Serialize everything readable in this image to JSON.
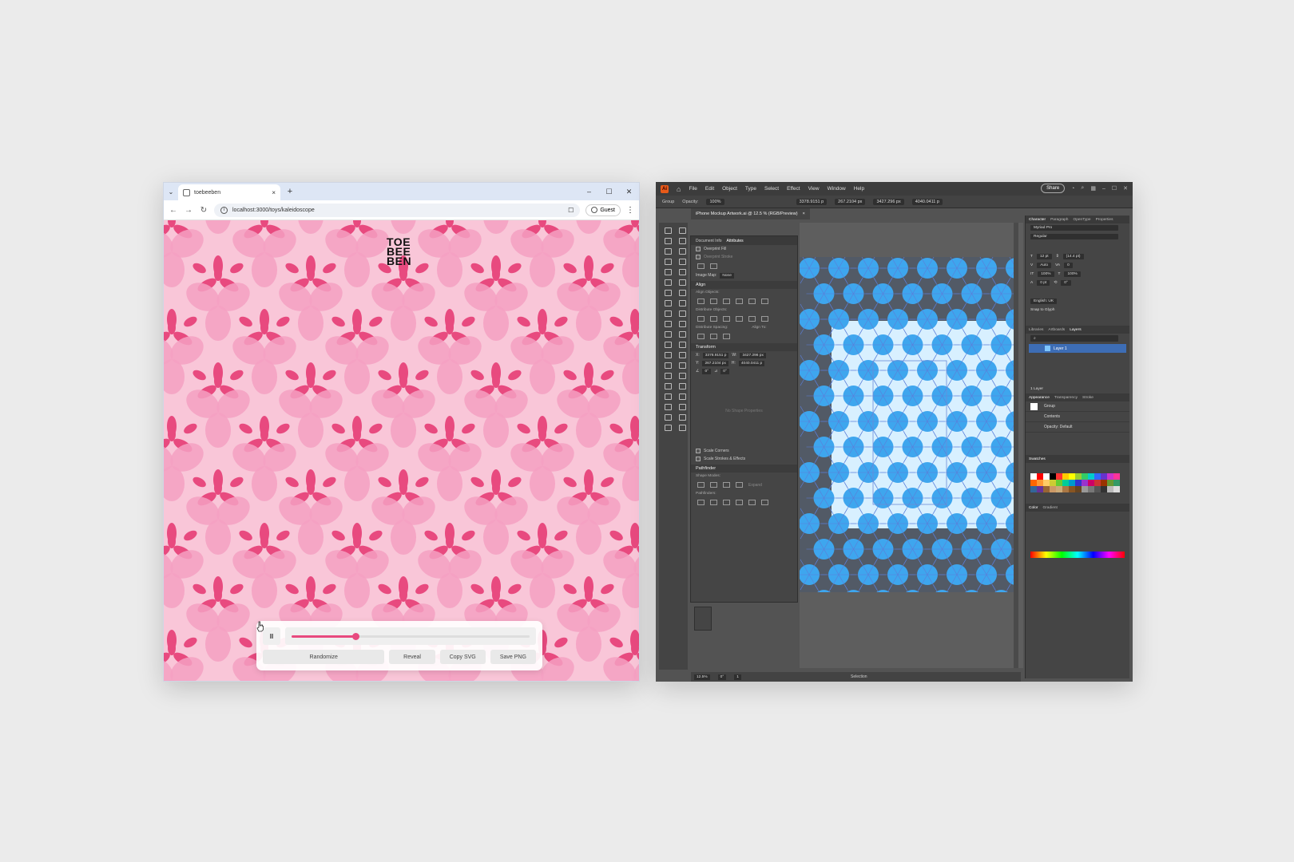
{
  "browser": {
    "tab_title": "toebeeben",
    "tab_close": "×",
    "new_tab": "+",
    "tab_menu": "⌄",
    "win_min": "–",
    "win_max": "☐",
    "win_close": "✕",
    "back": "←",
    "forward": "→",
    "reload": "↻",
    "url": "localhost:3000/toys/kaleidoscope",
    "bookmark": "☐",
    "profile_label": "Guest",
    "menu": "⋮"
  },
  "app": {
    "logo_lines": [
      "TOE",
      "BEE",
      "BEN"
    ],
    "background_color": "#f9c6d8",
    "petal_dark": "#e84a7f",
    "petal_light": "#f4a0c2",
    "pause_label": "II",
    "slider_progress": 0.27,
    "buttons": {
      "randomize": "Randomize",
      "reveal": "Reveal",
      "copy_svg": "Copy SVG",
      "save_png": "Save PNG"
    }
  },
  "illustrator": {
    "logo_text": "Ai",
    "home": "⌂",
    "menus": [
      "File",
      "Edit",
      "Object",
      "Type",
      "Select",
      "Effect",
      "View",
      "Window",
      "Help"
    ],
    "share": "Share",
    "control_bar": {
      "group_label": "Group",
      "opacity_label": "Opacity:",
      "opacity_value": "100%",
      "x_value": "3378.9151 p",
      "y_value": "267.2104 px",
      "w_value": "3427.296 px",
      "h_value": "4040.0411 p"
    },
    "doc_tab": "iPhone Mockup Artwork.ai @ 12.5 % (RGB/Preview)",
    "doc_tab_close": "×",
    "left_panel": {
      "tabs": [
        "Document Info",
        "Attributes"
      ],
      "overprint_fill": "Overprint Fill",
      "overprint_stroke": "Overprint Stroke",
      "image_map_label": "Image Map:",
      "image_map_value": "None",
      "align_head": "Align",
      "align_objects": "Align Objects:",
      "distribute_objects": "Distribute Objects:",
      "distribute_spacing": "Distribute Spacing:",
      "align_to": "Align To:",
      "transform_head": "Transform",
      "x_field": "3378.9151 p",
      "y_field": "267.2104 px",
      "w_field": "3427.296 px",
      "h_field": "4040.0411 p",
      "angle_field": "0°",
      "shear_field": "0°",
      "no_shape": "No Shape Properties",
      "scale_corners": "Scale Corners",
      "scale_strokes": "Scale Strokes & Effects",
      "pathfinder_head": "Pathfinder",
      "shape_modes": "Shape Modes:",
      "expand": "Expand",
      "pathfinders": "Pathfinders:"
    },
    "right_panel": {
      "char_tabs": [
        "Character",
        "Paragraph",
        "OpenType",
        "Properties"
      ],
      "font_family": "Myriad Pro",
      "font_style": "Regular",
      "font_size": "12 pt",
      "leading": "(14.4 pt)",
      "kerning": "Auto",
      "tracking": "0",
      "scale_v": "100%",
      "scale_h": "100%",
      "baseline": "0 pt",
      "rotation": "0°",
      "language": "English: UK",
      "snap_to_glyph": "Snap to Glyph",
      "layer_tabs": [
        "Libraries",
        "Artboards",
        "Layers"
      ],
      "layer_name": "Layer 1",
      "layer_count": "1 Layer",
      "appearance_tabs": [
        "Appearance",
        "Transparency",
        "Stroke"
      ],
      "appearance_group": "Group",
      "appearance_contents": "Contents",
      "appearance_opacity": "Opacity: Default",
      "swatches_tab": "Swatches",
      "color_tabs": [
        "Color",
        "Gradient"
      ],
      "swatch_colors": [
        "#ffffff",
        "#ff0000",
        "#ffffff",
        "#000000",
        "#ff3333",
        "#ffcc00",
        "#ffff00",
        "#99cc33",
        "#33cc66",
        "#00cccc",
        "#3366ff",
        "#6633cc",
        "#cc33cc",
        "#ff3399",
        "#ff6600",
        "#ff9933",
        "#ffcc66",
        "#cccc33",
        "#66cc33",
        "#00cc99",
        "#0099cc",
        "#3333cc",
        "#9933cc",
        "#cc0066",
        "#cc3333",
        "#993300",
        "#669933",
        "#339966",
        "#336699",
        "#663399",
        "#996633",
        "#cc9966",
        "#ccaa77",
        "#aa7744",
        "#885522",
        "#664422",
        "#999999",
        "#777777",
        "#555555",
        "#333333",
        "#bbbbbb",
        "#dddddd"
      ]
    },
    "status": {
      "zoom": "12.5%",
      "rotate": "0°",
      "artboard": "1",
      "tool": "Selection"
    },
    "pattern": {
      "dark": "#525a66",
      "circle": "#3ea6ee",
      "light_bg": "#d8f0ff",
      "line": "#5b7fd9"
    }
  }
}
